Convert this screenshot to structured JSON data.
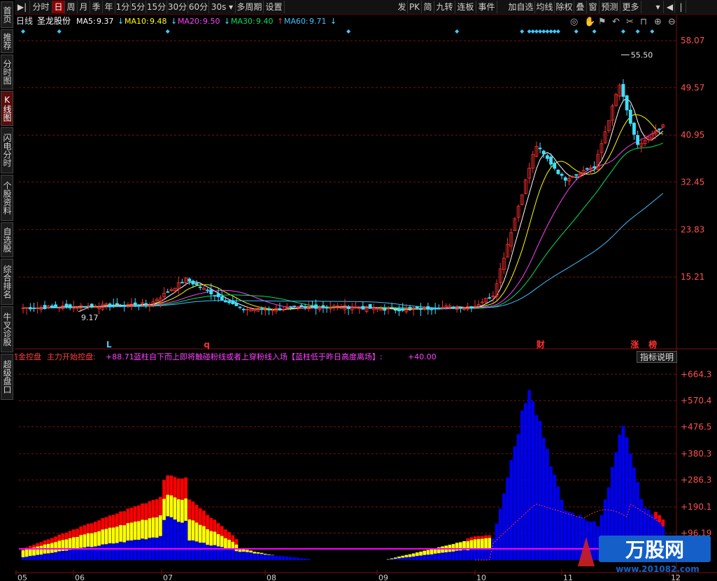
{
  "sidebar": {
    "items": [
      {
        "label": "首页",
        "active": false
      },
      {
        "label": "推荐",
        "active": false
      },
      {
        "label": "分时图",
        "active": false
      },
      {
        "label": "K线图",
        "active": true
      },
      {
        "label": "闪电分时",
        "active": false
      },
      {
        "label": "个股资料",
        "active": false
      },
      {
        "label": "自选股",
        "active": false
      },
      {
        "label": "综合排名",
        "active": false
      },
      {
        "label": "牛叉诊股",
        "active": false
      },
      {
        "label": "超级盘口",
        "active": false
      }
    ]
  },
  "toolbar": {
    "left_items": [
      "分时",
      "日",
      "周",
      "月",
      "季",
      "年",
      "1分",
      "5分",
      "15分",
      "30分",
      "60分",
      "30s",
      "多周期",
      "设置"
    ],
    "selected": "日",
    "right_items": [
      "发",
      "PK",
      "简",
      "九转",
      "连板",
      "事件",
      "加自选",
      "均线",
      "除权",
      "叠",
      "窗",
      "预测",
      "更多"
    ]
  },
  "main": {
    "period_label": "日线",
    "stock_name": "圣龙股份",
    "ma": [
      {
        "label": "MA5:",
        "value": "9.37",
        "arrow": "↓",
        "color": "#ffffff"
      },
      {
        "label": "MA10:",
        "value": "9.48",
        "arrow": "↓",
        "color": "#ffff00"
      },
      {
        "label": "MA20:",
        "value": "9.50",
        "arrow": "↓",
        "color": "#ff40ff"
      },
      {
        "label": "MA30:",
        "value": "9.40",
        "arrow": "↑",
        "color": "#00e060"
      },
      {
        "label": "MA60:",
        "value": "9.71",
        "arrow": "↓",
        "color": "#40c0ff"
      }
    ],
    "price_axis": [
      "58.07",
      "49.57",
      "40.95",
      "32.45",
      "23.83",
      "15.21"
    ],
    "price_ylim": [
      7.0,
      60.0
    ],
    "high_label": "55.50",
    "low_label": "9.17",
    "markers": [
      "L",
      "q",
      "财",
      "涨",
      "榜"
    ]
  },
  "sub": {
    "title": "资金控盘",
    "text1": "主力开始控盘:",
    "val1": "+88.71",
    "text2": "蓝柱自下而上即将触碰粉线或者上穿粉线入场【蓝柱低于昨日高度离场】:",
    "val2": "+40.00",
    "indicator_button": "指标说明",
    "axis": [
      "+664.3",
      "+570.4",
      "+476.5",
      "+380.3",
      "+286.3",
      "+190.1",
      "+96.19"
    ],
    "ylim": [
      0,
      700
    ]
  },
  "dates": [
    "05",
    "06",
    "07",
    "08",
    "09",
    "10",
    "11",
    "12"
  ],
  "watermark_text": "万股网",
  "watermark_url": "www.201082.com",
  "colors": {
    "up": "#ff3030",
    "down": "#40e0ff",
    "blue_bar": "#0000ee",
    "red_bar": "#ff0000",
    "yellow_bar": "#ffff00",
    "pink": "#ff00ff"
  }
}
